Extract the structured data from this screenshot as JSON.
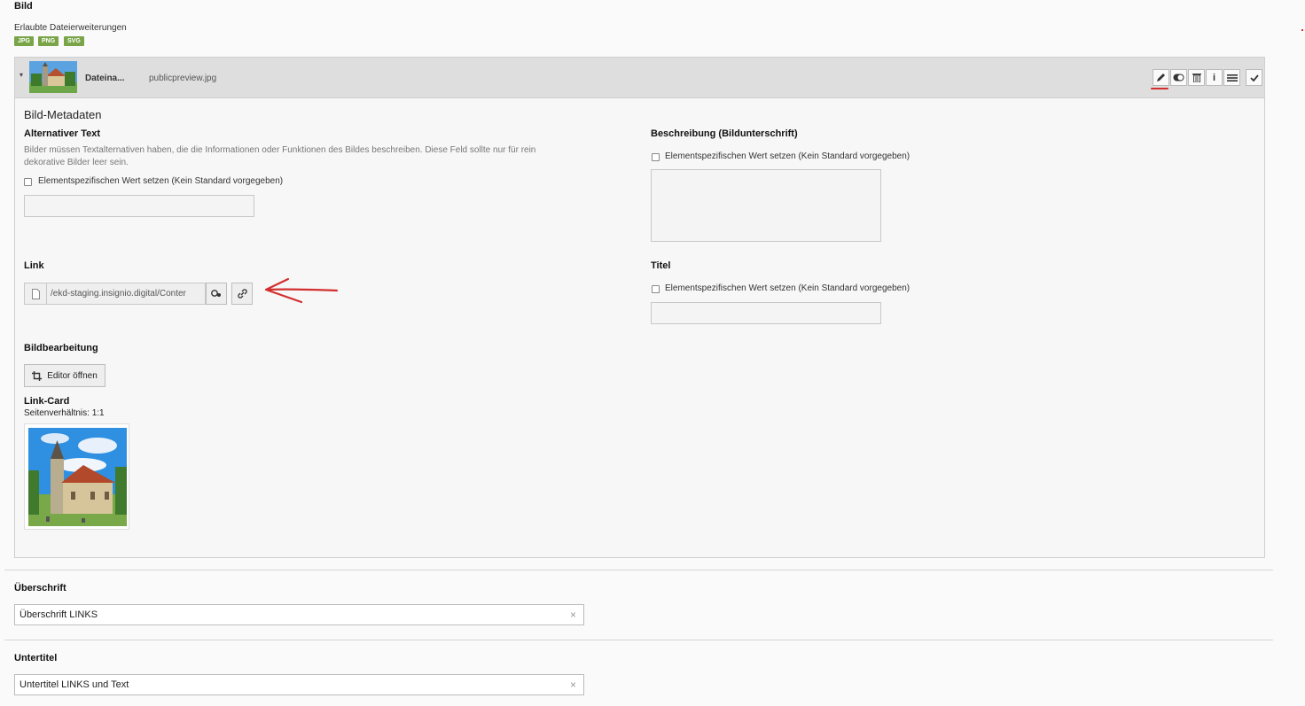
{
  "image_section": {
    "heading": "Bild",
    "extensions_label": "Erlaubte Dateierweiterungen",
    "extensions": [
      "JPG",
      "PNG",
      "SVG"
    ]
  },
  "file": {
    "label": "Dateina...",
    "filename": "publicpreview.jpg"
  },
  "toolbar": {
    "edit_icon": "pencil-icon",
    "toggle_icon": "toggle-icon",
    "delete_icon": "trash-icon",
    "info_icon": "info-icon",
    "drag_icon": "drag-handle-icon",
    "confirm_icon": "check-icon"
  },
  "metadata": {
    "title": "Bild-Metadaten",
    "alt_text": {
      "label": "Alternativer Text",
      "help_line1": "Bilder müssen Textalternativen haben, die die Informationen oder Funktionen des Bildes beschreiben. Diese Feld sollte nur für rein",
      "help_line2": "dekorative Bilder leer sein.",
      "checkbox_label": "Elementspezifischen Wert setzen (Kein Standard vorgegeben)",
      "value": ""
    },
    "description": {
      "label": "Beschreibung (Bildunterschrift)",
      "checkbox_label": "Elementspezifischen Wert setzen (Kein Standard vorgegeben)",
      "value": ""
    },
    "link": {
      "label": "Link",
      "value": "/ekd-staging.insignio.digital/Conter"
    },
    "title_field": {
      "label": "Titel",
      "checkbox_label": "Elementspezifischen Wert setzen (Kein Standard vorgegeben)",
      "value": ""
    },
    "image_editing": {
      "label": "Bildbearbeitung",
      "button": "Editor öffnen"
    },
    "link_card": {
      "label": "Link-Card",
      "ratio": "Seitenverhältnis: 1:1"
    }
  },
  "headline": {
    "label": "Überschrift",
    "value": "Überschrift LINKS"
  },
  "subtitle": {
    "label": "Untertitel",
    "value": "Untertitel LINKS und Text"
  },
  "annotation_color": "#d32f2f"
}
